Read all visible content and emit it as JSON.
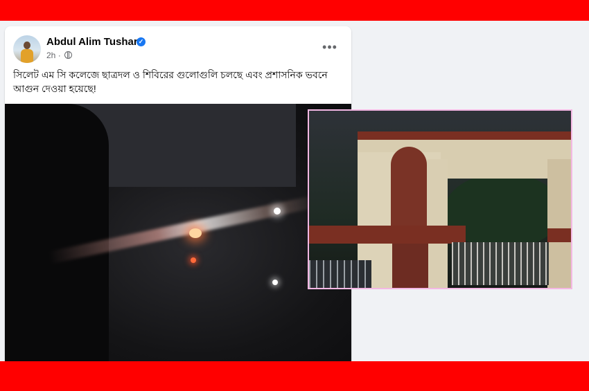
{
  "post": {
    "author": "Abdul Alim Tushar",
    "time": "2h",
    "menu_label": "•••",
    "verified_mark": "✓",
    "caption": "সিলেট এম সি কলেজে ছাত্রদল ও শিবিরের গুলোগুলি চলছে এবং প্রশাসনিক ভবনে আগুন দেওয়া হয়েছে!"
  },
  "icons": {
    "verified": "verified-badge-icon",
    "privacy": "globe-icon",
    "menu": "more-options-icon"
  },
  "colors": {
    "banner": "#ff0000",
    "verified": "#1877f2",
    "inset_border": "#f4b8e4"
  }
}
